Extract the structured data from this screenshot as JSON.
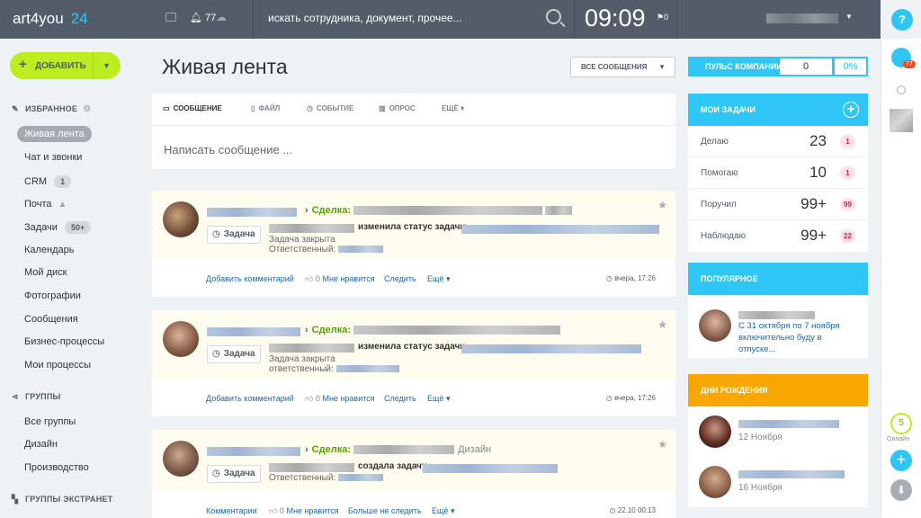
{
  "topbar": {
    "logo": "art4you",
    "logo_num": "24",
    "notif_count": "77",
    "search_placeholder": "искать сотрудника, документ, прочее...",
    "clock": "09:09",
    "flag_count": "0",
    "help": "?"
  },
  "sidebar": {
    "add_button": "ДОБАВИТЬ",
    "favorites_title": "ИЗБРАННОЕ",
    "favorites": [
      {
        "label": "Живая лента"
      },
      {
        "label": "Чат и звонки"
      },
      {
        "label": "CRM",
        "counter": "1"
      },
      {
        "label": "Почта"
      },
      {
        "label": "Задачи",
        "counter": "50+"
      },
      {
        "label": "Календарь"
      },
      {
        "label": "Мой диск"
      },
      {
        "label": "Фотографии"
      },
      {
        "label": "Сообщения"
      },
      {
        "label": "Бизнес-процессы"
      },
      {
        "label": "Мои процессы"
      }
    ],
    "groups_title": "ГРУППЫ",
    "groups": [
      {
        "label": "Все группы"
      },
      {
        "label": "Дизайн"
      },
      {
        "label": "Производство"
      }
    ],
    "extranet_title": "ГРУППЫ ЭКСТРАНЕТ"
  },
  "main": {
    "title": "Живая лента",
    "filter": "ВСЕ СООБЩЕНИЯ",
    "composer": {
      "tabs": [
        "СООБЩЕНИЕ",
        "ФАЙЛ",
        "СОБЫТИЕ",
        "ОПРОС",
        "ЕЩЁ"
      ],
      "placeholder": "Написать сообщение ..."
    },
    "posts": [
      {
        "deal_label": "Сделка:",
        "deal_extra": "",
        "button": "Задача",
        "action": "изменила статус задачи",
        "line2": "Задача закрыта",
        "line3": "Ответственный:",
        "comment": "Добавить комментарий",
        "likes": "0",
        "like_label": "Мне нравится",
        "follow": "Следить",
        "more": "Ещё",
        "time": "вчера, 17:26"
      },
      {
        "deal_label": "Сделка:",
        "deal_extra": "",
        "button": "Задача",
        "action": "изменила статус задачи",
        "line2": "Задача закрыта",
        "line3": "ответственный:",
        "comment": "Добавить комментарий",
        "likes": "0",
        "like_label": "Мне нравится",
        "follow": "Следить",
        "more": "Ещё",
        "time": "вчера, 17:26"
      },
      {
        "deal_label": "Сделка:",
        "deal_extra": "Дизайн",
        "button": "Задача",
        "action": "создала задачу",
        "line2": "Ответственный:",
        "line3": "",
        "comment": "Комментарии",
        "likes": "0",
        "like_label": "Мне нравится",
        "follow": "Больше не следить",
        "more": "Ещё",
        "time": "22.10 00:13"
      }
    ]
  },
  "right": {
    "pulse_label": "ПУЛЬС КОМПАНИИ",
    "pulse_value": "0",
    "pulse_percent": "0%",
    "tasks_title": "МОИ ЗАДАЧИ",
    "tasks": [
      {
        "label": "Делаю",
        "value": "23",
        "badge": "1"
      },
      {
        "label": "Помогаю",
        "value": "10",
        "badge": "1"
      },
      {
        "label": "Поручил",
        "value": "99+",
        "badge": "99"
      },
      {
        "label": "Наблюдаю",
        "value": "99+",
        "badge": "22"
      }
    ],
    "popular_title": "ПОПУЛЯРНОЕ",
    "popular_text": "С 31 октября по 7 ноября включительно буду в отпуске...",
    "birthdays_title": "ДНИ РОЖДЕНИЯ",
    "birthdays": [
      {
        "date": "12 Ноября"
      },
      {
        "date": "16 Ноября"
      }
    ]
  },
  "rpanel": {
    "bell_badge": "77",
    "online_count": "5",
    "online_label": "Онлайн"
  },
  "colors": {
    "topbar": "#535c69",
    "accent": "#2fc6f6",
    "green": "#bbed21",
    "orange": "#f7a700"
  }
}
